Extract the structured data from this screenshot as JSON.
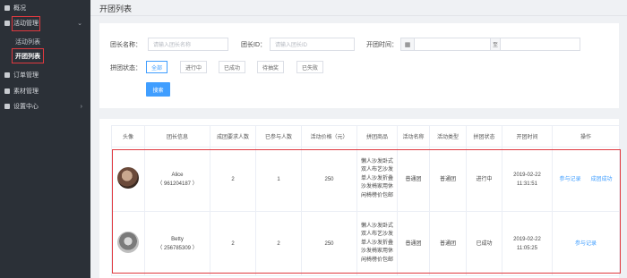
{
  "sidebar": {
    "items": [
      {
        "label": "概况",
        "icon": "dashboard-icon"
      },
      {
        "label": "活动管理",
        "icon": "activity-icon",
        "chevron": "⌄"
      },
      {
        "label": "订单管理",
        "icon": "order-icon"
      },
      {
        "label": "素材管理",
        "icon": "material-icon"
      },
      {
        "label": "设置中心",
        "icon": "gear-icon",
        "chevron": "›"
      }
    ],
    "subitems": [
      {
        "label": "活动列表"
      },
      {
        "label": "开团列表"
      }
    ]
  },
  "page": {
    "title": "开团列表"
  },
  "filters": {
    "leader_name_label": "团长名称：",
    "leader_name_placeholder": "请输入团长名称",
    "leader_id_label": "团长ID：",
    "leader_id_placeholder": "请输入团长ID",
    "open_time_label": "开团时间：",
    "date_separator": "至",
    "status_label": "拼团状态：",
    "status_options": [
      "全部",
      "进行中",
      "已成功",
      "待抽奖",
      "已失败"
    ],
    "search_button": "搜索"
  },
  "table": {
    "headers": [
      "头像",
      "团长信息",
      "成团要求人数",
      "已参与人数",
      "活动价格（元）",
      "拼团商品",
      "活动名称",
      "活动类型",
      "拼团状态",
      "开团时间",
      "操作"
    ],
    "rows": [
      {
        "avatar": "avatar-alice",
        "name": "Alice",
        "id": "（ 961204187 ）",
        "required": "2",
        "joined": "1",
        "price": "250",
        "goods": "懒人沙发卧式双人布艺沙发单人沙发折叠沙发椅家用休闲椅榜价包邮",
        "activity_name": "普通团",
        "activity_type": "普通团",
        "status": "进行中",
        "time": "2019-02-22 11:31:51",
        "ops": [
          "参与记录",
          "成团成功"
        ]
      },
      {
        "avatar": "avatar-betty",
        "name": "Betty",
        "id": "（ 256785309 ）",
        "required": "2",
        "joined": "2",
        "price": "250",
        "goods": "懒人沙发卧式双人布艺沙发单人沙发折叠沙发椅家用休闲椅榜价包邮",
        "activity_name": "普通团",
        "activity_type": "普通团",
        "status": "已成功",
        "time": "2019-02-22 11:05:25",
        "ops": [
          "参与记录"
        ]
      }
    ]
  },
  "colors": {
    "sidebar_bg": "#2b3037",
    "accent": "#409eff",
    "highlight": "#e0393f"
  }
}
